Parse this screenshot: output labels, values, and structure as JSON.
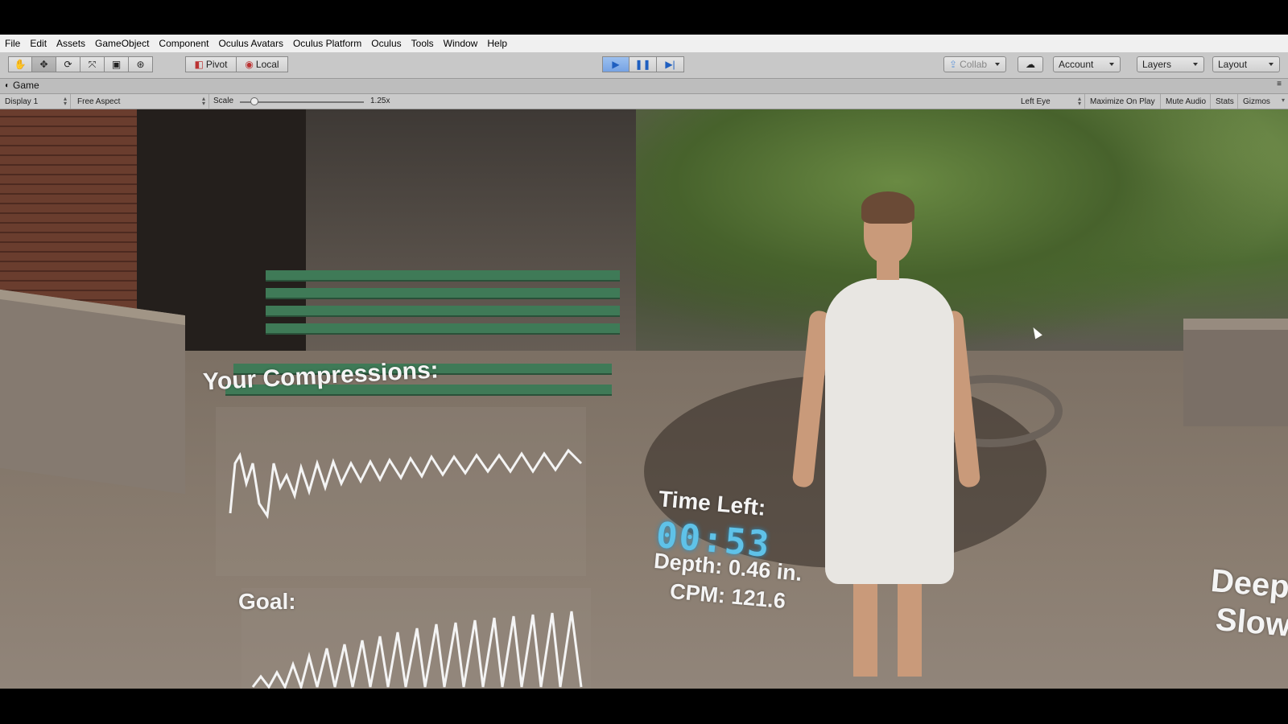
{
  "menu": [
    "File",
    "Edit",
    "Assets",
    "GameObject",
    "Component",
    "Oculus Avatars",
    "Oculus Platform",
    "Oculus",
    "Tools",
    "Window",
    "Help"
  ],
  "toolbar": {
    "pivot_label": "Pivot",
    "local_label": "Local",
    "collab_label": "Collab",
    "account_label": "Account",
    "layers_label": "Layers",
    "layout_label": "Layout"
  },
  "game_tab": {
    "title": "Game"
  },
  "game_options": {
    "display": "Display 1",
    "aspect": "Free Aspect",
    "scale_label": "Scale",
    "scale_value": "1.25x",
    "scale_fraction": 0.12,
    "eye": "Left Eye",
    "maximize": "Maximize On Play",
    "mute": "Mute Audio",
    "stats": "Stats",
    "gizmos": "Gizmos"
  },
  "hud": {
    "compressions_label": "Your Compressions:",
    "goal_label": "Goal:",
    "time_left_label": "Time Left:",
    "timer_value": "00:53",
    "depth": "Depth: 0.46 in.",
    "cpm": "CPM: 121.6",
    "hint_line1": "Deep",
    "hint_line2": "Slow"
  },
  "colors": {
    "accent_play": "#3a7bd5",
    "timer": "#5fc2e8",
    "bench": "#3f7a57"
  }
}
